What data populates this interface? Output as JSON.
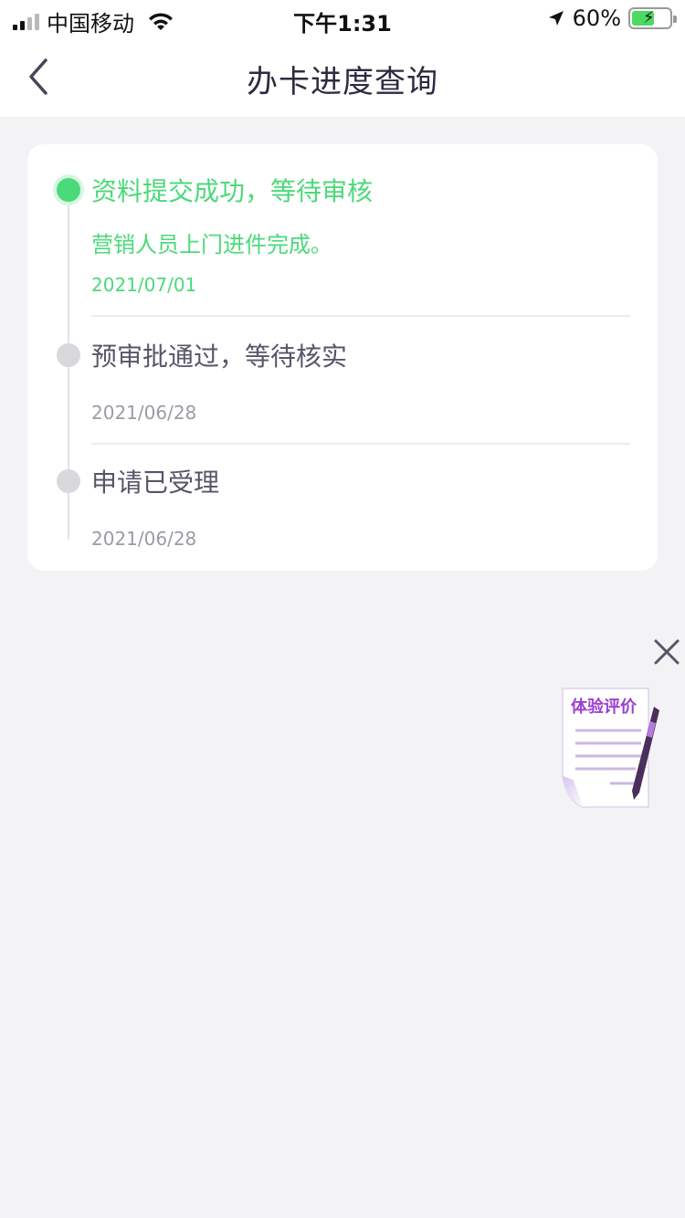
{
  "status_bar": {
    "carrier": "中国移动",
    "time": "下午1:31",
    "battery_percent": "60%",
    "battery_level": 0.6
  },
  "nav": {
    "title": "办卡进度查询",
    "back_icon": "chevron-left-icon"
  },
  "timeline": [
    {
      "title": "资料提交成功，等待审核",
      "description": "营销人员上门进件完成。",
      "date": "2021/07/01",
      "active": true
    },
    {
      "title": "预审批通过，等待核实",
      "description": "",
      "date": "2021/06/28",
      "active": false
    },
    {
      "title": "申请已受理",
      "description": "",
      "date": "2021/06/28",
      "active": false
    }
  ],
  "floating": {
    "close_icon": "close-icon",
    "feedback_label": "体验评价",
    "feedback_icon": "document-pen-icon"
  },
  "colors": {
    "active_green": "#4cd97a",
    "inactive_gray": "#d8d8dc",
    "feedback_purple": "#9c3fd0"
  }
}
